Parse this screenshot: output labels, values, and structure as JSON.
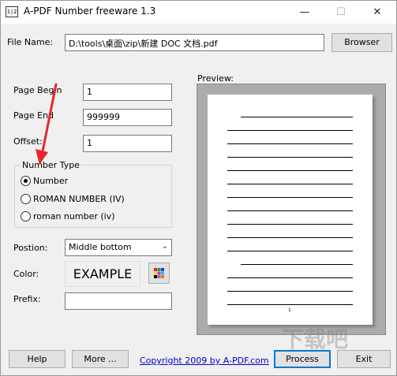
{
  "window": {
    "title": "A-PDF Number freeware 1.3",
    "icon_label": "1|2",
    "min_glyph": "—",
    "max_glyph": "☐",
    "close_glyph": "✕"
  },
  "file": {
    "label": "File Name:",
    "value": "D:\\tools\\桌面\\zip\\新建 DOC 文档.pdf",
    "browse_label": "Browser"
  },
  "page_begin": {
    "label": "Page Begin",
    "value": "1"
  },
  "page_end": {
    "label": "Page End",
    "value": "999999"
  },
  "offset": {
    "label": "Offset:",
    "value": "1"
  },
  "number_type": {
    "title": "Number Type",
    "options": [
      {
        "label": "Number",
        "checked": true
      },
      {
        "label": "ROMAN NUMBER (IV)",
        "checked": false
      },
      {
        "label": "roman number (iv)",
        "checked": false
      }
    ]
  },
  "position": {
    "label": "Postion:",
    "value": "Middle bottom"
  },
  "color": {
    "label": "Color:",
    "example_text": "EXAMPLE",
    "accent": "#000000"
  },
  "prefix": {
    "label": "Prefix:",
    "value": ""
  },
  "preview": {
    "label": "Preview:",
    "page_number": "1"
  },
  "footer": {
    "help_label": "Help",
    "more_label": "More ...",
    "copyright_link": "Copyright 2009 by A-PDF.com",
    "process_label": "Process",
    "exit_label": "Exit"
  },
  "watermark_text": "下载吧",
  "annotation_arrow_color": "#e8262a"
}
